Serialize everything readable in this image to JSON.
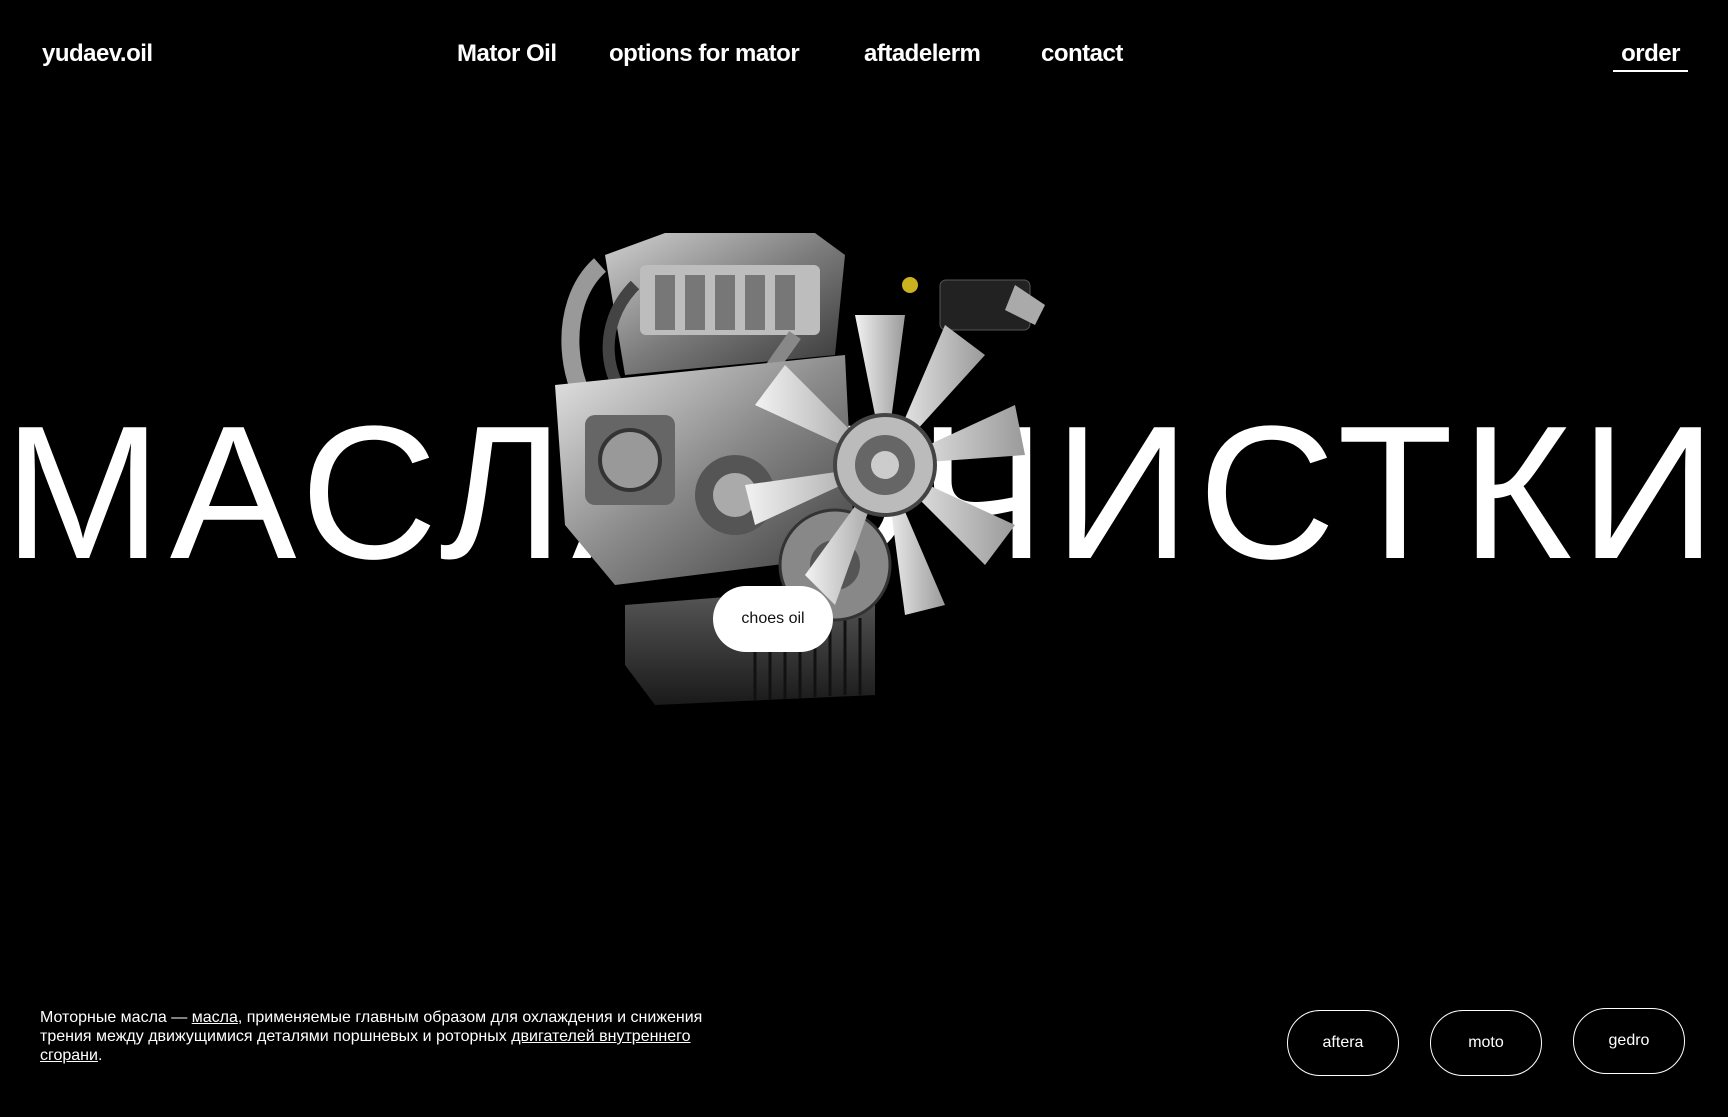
{
  "header": {
    "logo": "yudaev.oil",
    "nav": [
      {
        "label": "Mator Oil"
      },
      {
        "label": "options for mator"
      },
      {
        "label": "aftadelerm"
      },
      {
        "label": "contact"
      }
    ],
    "order_label": "order"
  },
  "hero": {
    "title": "МАСЛА ОЧИСТКИ",
    "cta_label": "choes oil",
    "image_icon": "engine-illustration"
  },
  "footer": {
    "description": {
      "part1": "Моторные масла — ",
      "link1": "масла",
      "part2": ", применяемые главным образом для охлаждения и снижения трения между движущимися деталями поршневых и роторных ",
      "link2": "двигателей внутреннего сгорани",
      "part3": "."
    },
    "categories": [
      {
        "label": "aftera"
      },
      {
        "label": "moto"
      },
      {
        "label": "gedro"
      }
    ]
  },
  "colors": {
    "background": "#000000",
    "text": "#ffffff",
    "button_bg": "#ffffff",
    "button_text": "#111111"
  }
}
